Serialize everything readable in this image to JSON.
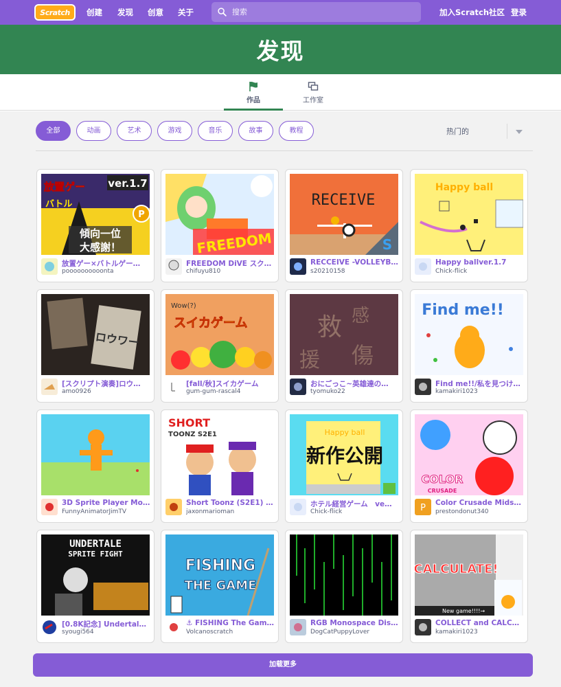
{
  "nav": {
    "logo": "Scratch",
    "create": "创建",
    "explore": "发现",
    "ideas": "创意",
    "about": "关于",
    "search_placeholder": "搜索",
    "join": "加入Scratch社区",
    "sign_in": "登录"
  },
  "banner": {
    "title": "发现"
  },
  "tabs": [
    {
      "label": "作品",
      "icon": "flag-icon",
      "active": true
    },
    {
      "label": "工作室",
      "icon": "studio-icon",
      "active": false
    }
  ],
  "filters": [
    "全部",
    "动画",
    "艺术",
    "游戏",
    "音乐",
    "故事",
    "教程"
  ],
  "active_filter": "全部",
  "sort": {
    "selected": "热门的"
  },
  "projects": [
    {
      "title": "放置ゲー×バトルゲー…",
      "author": "poooooooooonta",
      "thumb_text": "放置ゲー×バトルゲー ver.1.7 傾向一位 大感謝！"
    },
    {
      "title": "FREEDOM DiVE スク…",
      "author": "chifuyu810",
      "thumb_text": "FREEDOM DiVE"
    },
    {
      "title": "RECCEIVE -VOLLEYB…",
      "author": "s20210158",
      "thumb_text": "RECEIVE"
    },
    {
      "title": "Happy ballver.1.7",
      "author": "Chick-flick",
      "thumb_text": "Happy ball"
    },
    {
      "title": "[スクリプト演奏]ロウ…",
      "author": "amo0926",
      "thumb_text": "ロウワー"
    },
    {
      "title": "[fall/秋]スイカゲーム",
      "author": "gum-gum-rascal4",
      "thumb_text": "スイカゲーム"
    },
    {
      "title": "おにごっこ~英雄達の…",
      "author": "tyomuko22",
      "thumb_text": "救援 英雄 感傷"
    },
    {
      "title": "Find me!!/私を見つけ…",
      "author": "kamakiri1023",
      "thumb_text": "Find me!!"
    },
    {
      "title": "3D Sprite Player Model",
      "author": "FunnyAnimatorJimTV",
      "thumb_text": ""
    },
    {
      "title": "Short Toonz (S2E1) - …",
      "author": "jaxonmarioman",
      "thumb_text": "SHORT TOONZ S2E1"
    },
    {
      "title": "ホテル経営ゲーム　ve…",
      "author": "Chick-flick",
      "thumb_text": "新作公開"
    },
    {
      "title": "Color Crusade Midse…",
      "author": "prestondonut340",
      "thumb_text": "COLOR CRUSADE"
    },
    {
      "title": "[0.8K記念] Undertale …",
      "author": "syougi564",
      "thumb_text": "UNDERTALE SPRITE FIGHT"
    },
    {
      "title": "⚓ FISHING The Gam…",
      "author": "Volcanoscratch",
      "thumb_text": "FISHING THE GAME"
    },
    {
      "title": "RGB Monospace Dis…",
      "author": "DogCatPuppyLover",
      "thumb_text": ""
    },
    {
      "title": "COLLECT and CALC…",
      "author": "kamakiri1023",
      "thumb_text": "CALCULATE!"
    }
  ],
  "load_more": "加载更多",
  "colors": {
    "nav": "#855cd6",
    "banner": "#328552",
    "link": "#855cd6"
  }
}
